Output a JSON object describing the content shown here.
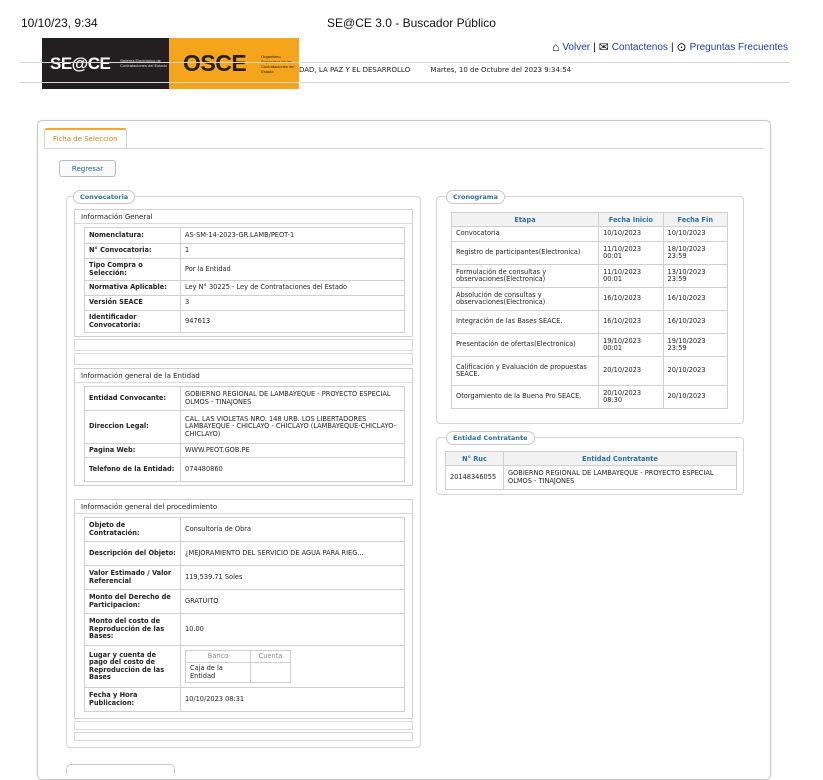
{
  "print_header": {
    "datetime": "10/10/23, 9:34",
    "page_title": "SE@CE 3.0 - Buscador Público"
  },
  "banner": {
    "seace_logo": "SE@CE",
    "seace_sub": "Sistema Electrónico de Contrataciones del Estado",
    "osce_logo": "OSCE",
    "osce_sub": "Organismo Supervisor de las Contrataciones del Estado"
  },
  "top_links": {
    "back": "Volver",
    "contact": "Contactenos",
    "faq": "Preguntas Frecuentes",
    "separator": "|"
  },
  "header_bar": {
    "slogan": "DAD, LA PAZ Y EL DESARROLLO",
    "date": "Martes, 10 de Octubre del 2023 9:34:54"
  },
  "tab": {
    "label": "Ficha de Seleccion"
  },
  "back_button": "Regresar",
  "convocatoria": {
    "legend": "Convocatoria",
    "general": {
      "title": "Información General",
      "rows": [
        {
          "k": "Nomenclatura:",
          "v": "AS-SM-14-2023-GR.LAMB/PEOT-1"
        },
        {
          "k": "N° Convocatoria:",
          "v": "1"
        },
        {
          "k": "Tipo Compra o Selección:",
          "v": "Por la Entidad"
        },
        {
          "k": "Normativa Aplicable:",
          "v": "Ley N° 30225 - Ley de Contrataciones del Estado"
        },
        {
          "k": "Versión SEACE",
          "v": "3"
        },
        {
          "k": "Identificador Convocatoria:",
          "v": "947613"
        }
      ]
    },
    "entidad": {
      "title": "Información general de la Entidad",
      "rows": [
        {
          "k": "Entidad Convocante:",
          "v": "GOBIERNO REGIONAL DE LAMBAYEQUE - PROYECTO ESPECIAL OLMOS - TINAJONES"
        },
        {
          "k": "Direccion Legal:",
          "v": "CAL. LAS VIOLETAS NRO. 148 URB. LOS LIBERTADORES LAMBAYEQUE - CHICLAYO - CHICLAYO (LAMBAYEQUE-CHICLAYO-CHICLAYO)"
        },
        {
          "k": "Pagina Web:",
          "v": "WWW.PEOT.GOB.PE"
        },
        {
          "k": "Telefono de la Entidad:",
          "v": "074480860"
        }
      ]
    },
    "procedimiento": {
      "title": "Información general del procedimiento",
      "rows": [
        {
          "k": "Objeto de Contratación:",
          "v": "Consultoría de Obra"
        },
        {
          "k": "Descripción del Objeto:",
          "v": "¿MEJORAMIENTO DEL SERVICIO DE AGUA PARA RIEG..."
        },
        {
          "k": "Valor Estimado / Valor Referencial",
          "v": "119,539.71 Soles"
        },
        {
          "k": "Monto del Derecho de Participacion:",
          "v": "GRATUITO"
        },
        {
          "k": "Monto del costo de Reproducción de las Bases:",
          "v": "10.00"
        },
        {
          "k": "Lugar y cuenta de pago del costo de Reproducción de las Bases",
          "v": ""
        },
        {
          "k": "Fecha y Hora Publicacion:",
          "v": "10/10/2023 08:31"
        }
      ],
      "payment": {
        "bank_placeholder": "Banco",
        "account_placeholder": "Cuenta",
        "bank_value": "Caja de la Entidad",
        "account_value": ""
      }
    }
  },
  "cronograma": {
    "legend": "Cronograma",
    "headers": [
      "Etapa",
      "Fecha Inicio",
      "Fecha Fin"
    ],
    "rows": [
      [
        "Convocatoria",
        "10/10/2023",
        "10/10/2023"
      ],
      [
        "Registro de participantes(Electronica)",
        "11/10/2023 00:01",
        "18/10/2023 23:59"
      ],
      [
        "Formulación de consultas y observaciones(Electronica)",
        "11/10/2023 00:01",
        "13/10/2023 23:59"
      ],
      [
        "Absolución de consultas y observaciones(Electronica)",
        "16/10/2023",
        "16/10/2023"
      ],
      [
        "Integración de las Bases SEACE.",
        "16/10/2023",
        "16/10/2023"
      ],
      [
        "Presentación de ofertas(Electronica)",
        "19/10/2023 00:01",
        "19/10/2023 23:59"
      ],
      [
        "Calificación y Evaluación de propuestas SEACE.",
        "20/10/2023",
        "20/10/2023"
      ],
      [
        "Otorgamiento de la Buena Pro SEACE.",
        "20/10/2023 08:30",
        "20/10/2023"
      ]
    ]
  },
  "entidad_contratante": {
    "legend": "Entidad Contratante",
    "headers": [
      "N° Ruc",
      "Entidad Contratante"
    ],
    "rows": [
      [
        "20148346055",
        "GOBIERNO REGIONAL DE LAMBAYEQUE - PROYECTO ESPECIAL OLMOS - TINAJONES"
      ]
    ]
  }
}
